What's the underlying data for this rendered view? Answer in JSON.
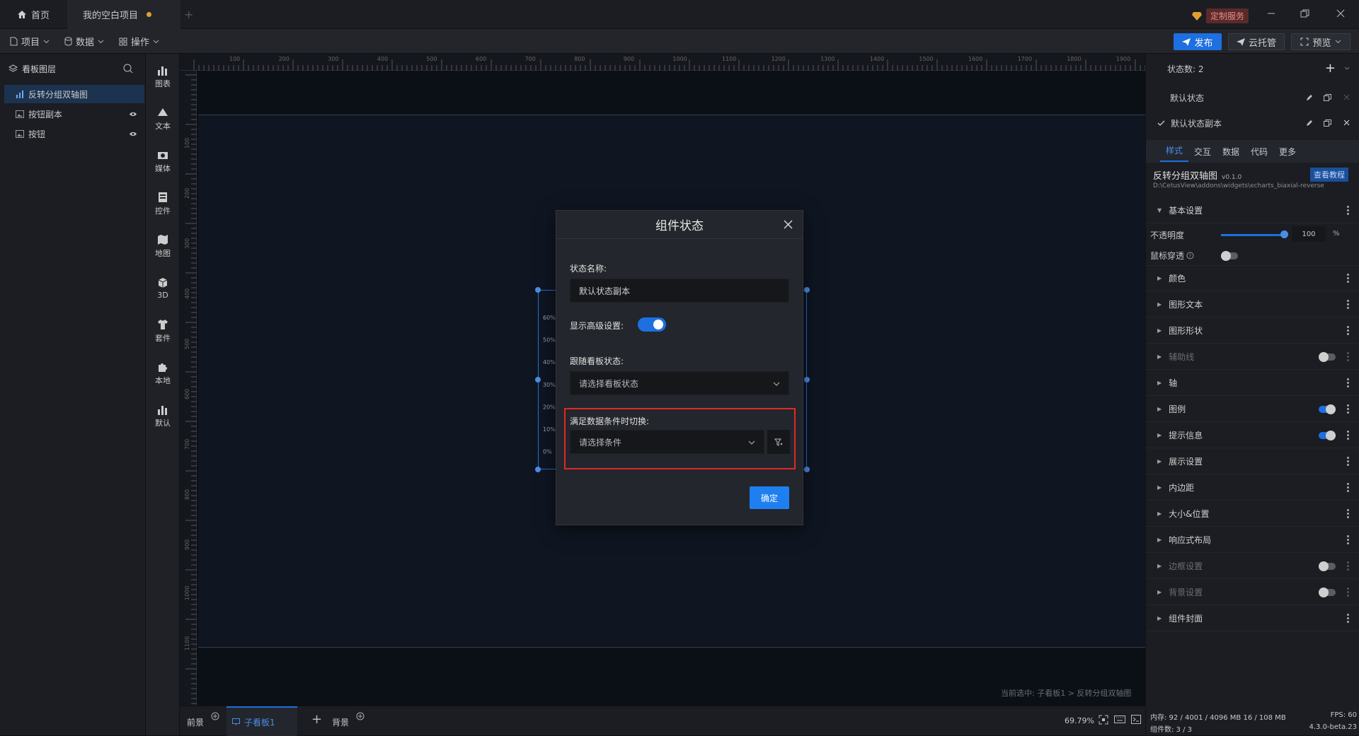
{
  "tabs": {
    "home": "首页",
    "project": "我的空白项目"
  },
  "top_right": {
    "custom_service": "定制服务"
  },
  "toolbar": {
    "project": "项目",
    "data": "数据",
    "ops": "操作",
    "publish": "发布",
    "cloud": "云托管",
    "preview": "预览"
  },
  "layers": {
    "title": "看板图层",
    "items": [
      "反转分组双轴图",
      "按钮副本",
      "按钮"
    ]
  },
  "iconbar": [
    "图表",
    "文本",
    "媒体",
    "控件",
    "地图",
    "3D",
    "套件",
    "本地",
    "默认"
  ],
  "ruler_top": [
    "100",
    "200",
    "300",
    "400",
    "500",
    "600",
    "700",
    "800",
    "900",
    "1000",
    "1100",
    "1200",
    "1300",
    "1400",
    "1500",
    "1600",
    "1700",
    "1800",
    "1900"
  ],
  "ruler_left": [
    "100",
    "200",
    "300",
    "400",
    "500",
    "600",
    "700",
    "800",
    "900",
    "1000",
    "1100"
  ],
  "chart_axis": [
    "60%",
    "50%",
    "40%",
    "30%",
    "20%",
    "10%",
    "0%"
  ],
  "canvas_status": "当前选中: 子看板1 > 反转分组双轴图",
  "bottom": {
    "front": "前景",
    "subboard": "子看板1",
    "back": "背景",
    "zoom": "69.79%"
  },
  "dialog": {
    "title": "组件状态",
    "name_label": "状态名称:",
    "name_value": "默认状态副本",
    "advanced_label": "显示高级设置:",
    "follow_label": "跟随看板状态:",
    "follow_placeholder": "请选择看板状态",
    "condition_label": "满足数据条件时切换:",
    "condition_placeholder": "请选择条件",
    "ok": "确定"
  },
  "right": {
    "state_count": "状态数: 2",
    "state1": "默认状态",
    "state2": "默认状态副本",
    "tabs": [
      "样式",
      "交互",
      "数据",
      "代码",
      "更多"
    ],
    "widget_name": "反转分组双轴图",
    "widget_version": "v0.1.0",
    "tutorial": "查看教程",
    "widget_path": "D:\\CetusView\\addons\\widgets\\echarts_biaxial-reverse",
    "basic": "基本设置",
    "opacity_label": "不透明度",
    "opacity_value": "100",
    "opacity_unit": "%",
    "mouse_label": "鼠标穿透",
    "sections": [
      "颜色",
      "图形文本",
      "图形形状",
      "辅助线",
      "轴",
      "图例",
      "提示信息",
      "展示设置",
      "内边距",
      "大小&位置",
      "响应式布局",
      "边框设置",
      "背景设置",
      "组件封面"
    ],
    "memory": "内存: 92 / 4001 / 4096 MB  16 / 108 MB",
    "fps": "FPS: 60",
    "count": "组件数: 3 / 3",
    "version": "4.3.0-beta.23"
  },
  "colors": {
    "accent": "#1e6fe0",
    "highlight_border": "#e02828",
    "dialog_bg": "#23262c"
  }
}
